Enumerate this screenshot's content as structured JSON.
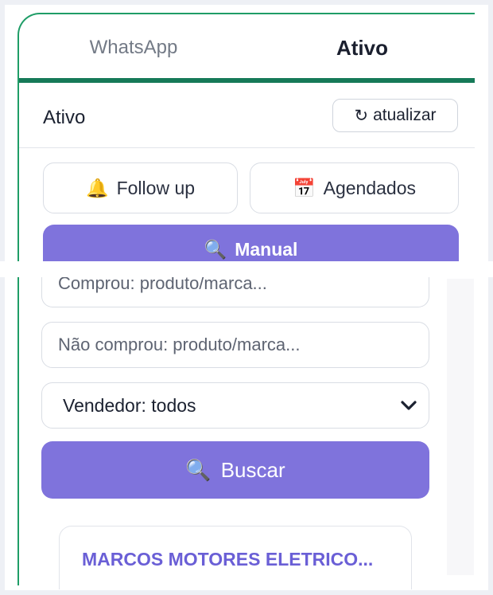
{
  "tabs": [
    {
      "label": "WhatsApp",
      "active": false
    },
    {
      "label": "Ativo",
      "active": true
    }
  ],
  "header": {
    "title": "Ativo",
    "refresh_icon": "↻",
    "refresh_label": "atualizar"
  },
  "quick_actions": {
    "follow_up": {
      "icon": "bell-icon",
      "glyph": "🔔",
      "label": "Follow up"
    },
    "agendados": {
      "icon": "calendar-icon",
      "glyph": "📅",
      "label": "Agendados"
    },
    "manual": {
      "icon": "magnifier-icon",
      "glyph": "🔍",
      "label": "Manual"
    }
  },
  "filters": {
    "comprou_placeholder": "Comprou: produto/marca...",
    "nao_comprou_placeholder": "Não comprou: produto/marca...",
    "vendedor_selected": "Vendedor: todos"
  },
  "search": {
    "icon": "magnifier-icon",
    "glyph": "🔍",
    "label": "Buscar"
  },
  "results": [
    {
      "name": "MARCOS MOTORES ELETRICO..."
    }
  ],
  "colors": {
    "accent": "#7f73dc",
    "brand_green": "#167a58",
    "card_title": "#6a5fd6"
  }
}
